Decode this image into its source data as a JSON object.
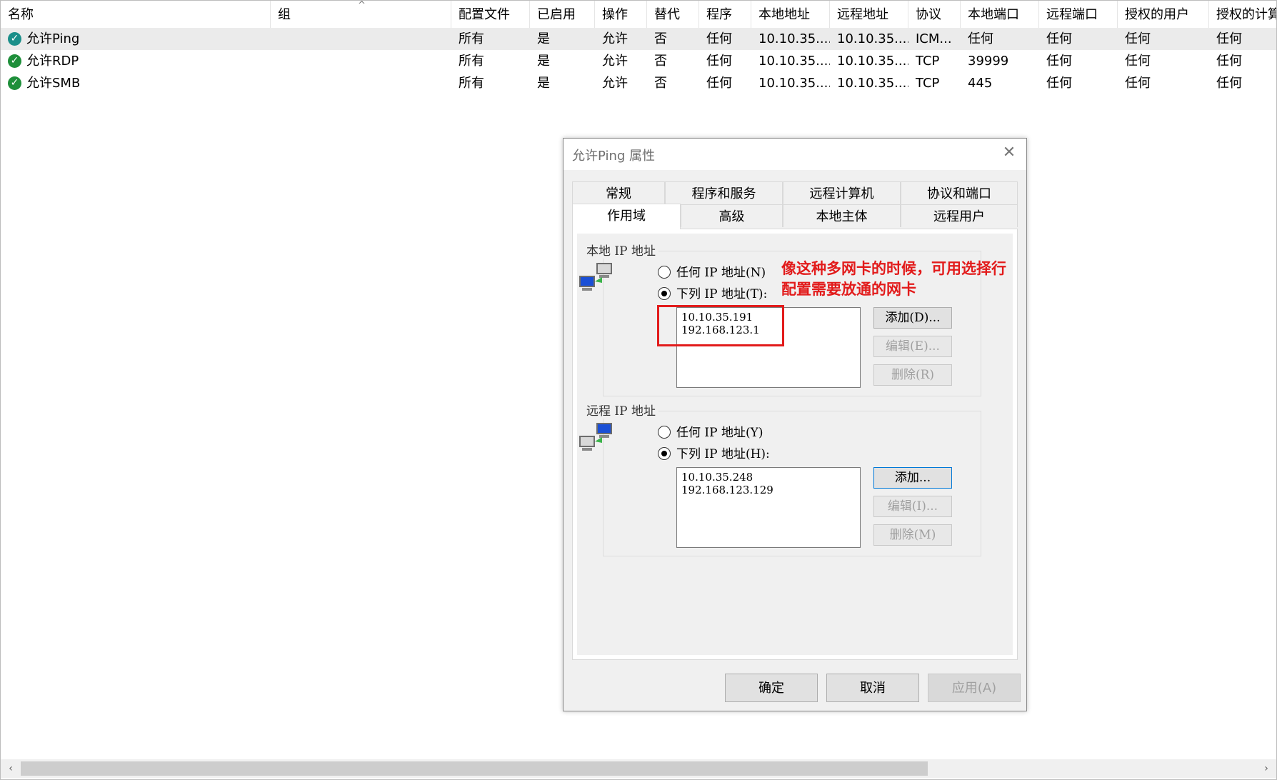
{
  "table": {
    "columns": [
      "名称",
      "组",
      "配置文件",
      "已启用",
      "操作",
      "替代",
      "程序",
      "本地地址",
      "远程地址",
      "协议",
      "本地端口",
      "远程端口",
      "授权的用户",
      "授权的计算"
    ],
    "rows": [
      {
        "name": "允许Ping",
        "group": "",
        "profile": "所有",
        "enabled": "是",
        "action": "允许",
        "override": "否",
        "program": "任何",
        "local_addr": "10.10.35....",
        "remote_addr": "10.10.35....",
        "protocol": "ICM...",
        "local_port": "任何",
        "remote_port": "任何",
        "auth_users": "任何",
        "auth_computers": "任何",
        "selected": true
      },
      {
        "name": "允许RDP",
        "group": "",
        "profile": "所有",
        "enabled": "是",
        "action": "允许",
        "override": "否",
        "program": "任何",
        "local_addr": "10.10.35....",
        "remote_addr": "10.10.35....",
        "protocol": "TCP",
        "local_port": "39999",
        "remote_port": "任何",
        "auth_users": "任何",
        "auth_computers": "任何",
        "selected": false
      },
      {
        "name": "允许SMB",
        "group": "",
        "profile": "所有",
        "enabled": "是",
        "action": "允许",
        "override": "否",
        "program": "任何",
        "local_addr": "10.10.35....",
        "remote_addr": "10.10.35....",
        "protocol": "TCP",
        "local_port": "445",
        "remote_port": "任何",
        "auth_users": "任何",
        "auth_computers": "任何",
        "selected": false
      }
    ],
    "sort_indicator": "^",
    "check_glyph": "✓"
  },
  "scrollbar": {
    "left_arrow": "‹",
    "right_arrow": "›"
  },
  "dialog": {
    "title": "允许Ping 属性",
    "close_glyph": "✕",
    "tabs_row1": [
      "常规",
      "程序和服务",
      "远程计算机",
      "协议和端口"
    ],
    "tabs_row2": [
      "作用域",
      "高级",
      "本地主体",
      "远程用户"
    ],
    "active_tab": "作用域",
    "local": {
      "legend": "本地 IP 地址",
      "opt_any": "任何 IP 地址(N)",
      "opt_list": "下列 IP 地址(T):",
      "selected": "list",
      "addresses": [
        "10.10.35.191",
        "192.168.123.1"
      ],
      "btn_add": "添加(D)...",
      "btn_edit": "编辑(E)...",
      "btn_remove": "删除(R)"
    },
    "remote": {
      "legend": "远程 IP 地址",
      "opt_any": "任何 IP 地址(Y)",
      "opt_list": "下列 IP 地址(H):",
      "selected": "list",
      "addresses": [
        "10.10.35.248",
        "192.168.123.129"
      ],
      "btn_add": "添加...",
      "btn_edit": "编辑(I)...",
      "btn_remove": "删除(M)"
    },
    "footer": {
      "ok": "确定",
      "cancel": "取消",
      "apply": "应用(A)"
    }
  },
  "annotation": {
    "line1": "像这种多网卡的时候，可用选择行",
    "line2": "配置需要放通的网卡",
    "color": "#e21b1b"
  }
}
